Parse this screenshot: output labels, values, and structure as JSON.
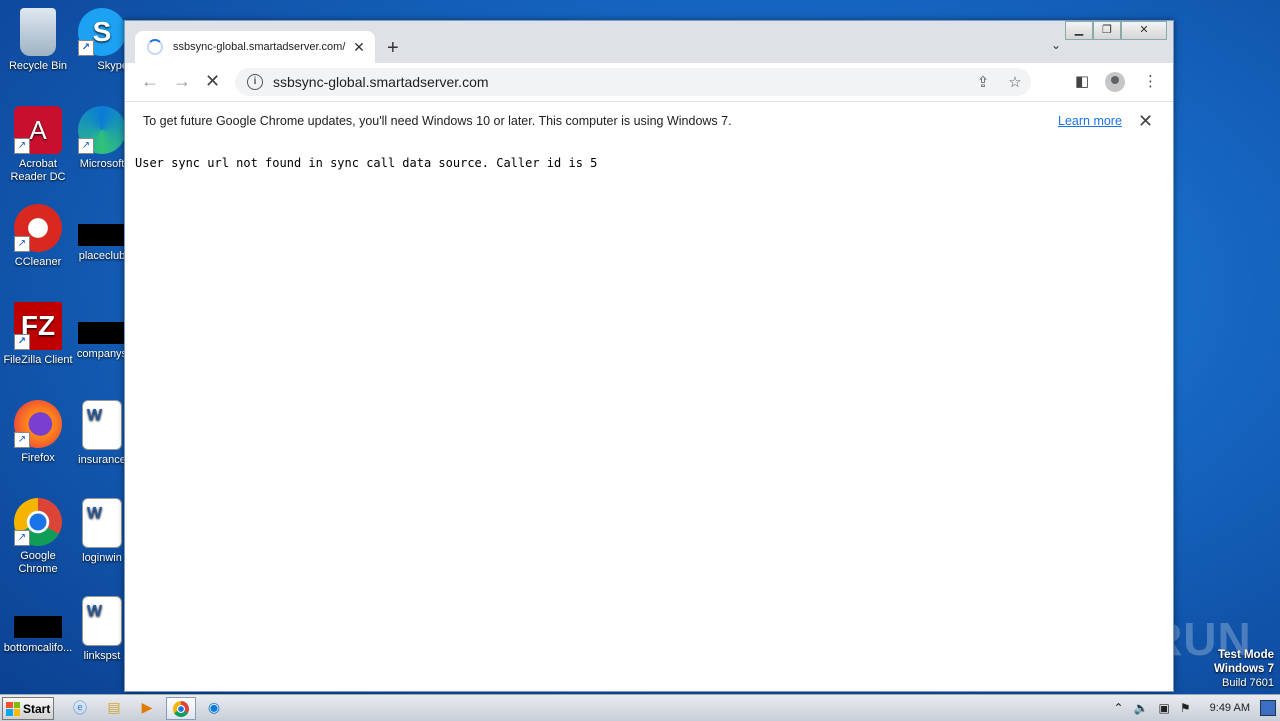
{
  "desktop": {
    "icons": [
      {
        "label": "Recycle Bin"
      },
      {
        "label": "Skype"
      },
      {
        "label": "Acrobat Reader DC"
      },
      {
        "label": "Microsoft"
      },
      {
        "label": "CCleaner"
      },
      {
        "label": "placeclub"
      },
      {
        "label": "FileZilla Client"
      },
      {
        "label": "companys"
      },
      {
        "label": "Firefox"
      },
      {
        "label": "insurance"
      },
      {
        "label": "Google Chrome"
      },
      {
        "label": "loginwin"
      },
      {
        "label": "bottomcalifo..."
      },
      {
        "label": "linkspst"
      }
    ]
  },
  "browser": {
    "tab_title": "ssbsync-global.smartadserver.com/",
    "new_tab": "+",
    "url": "ssbsync-global.smartadserver.com",
    "infobar": {
      "message": "To get future Google Chrome updates, you'll need Windows 10 or later. This computer is using Windows 7.",
      "link": "Learn more"
    },
    "page_text": "User sync url not found in sync call data source. Caller id is 5"
  },
  "watermark": {
    "brand": "ANY RUN",
    "line1": "Test Mode",
    "line2": "Windows 7",
    "line3": "Build 7601"
  },
  "taskbar": {
    "start_label": "Start",
    "clock": "9:49 AM"
  }
}
